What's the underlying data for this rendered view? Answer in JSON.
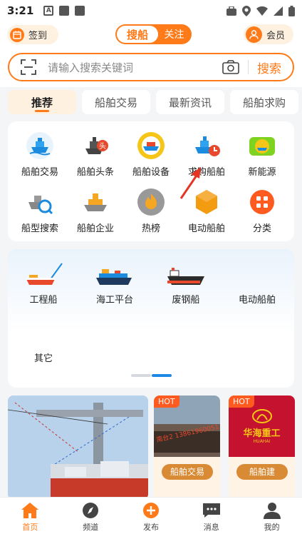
{
  "status_bar": {
    "time": "3:21"
  },
  "header": {
    "signin_label": "签到",
    "seg_active": "搜船",
    "seg_inactive": "关注",
    "member_label": "会员"
  },
  "search": {
    "placeholder": "请输入搜索关键词",
    "button": "搜索"
  },
  "tabs": [
    "推荐",
    "船舶交易",
    "最新资讯",
    "船舶求购"
  ],
  "grid": {
    "row1": [
      "船舶交易",
      "船舶头条",
      "船舶设备",
      "求购船舶",
      "新能源"
    ],
    "row2": [
      "船型搜索",
      "船舶企业",
      "热榜",
      "电动船舶",
      "分类"
    ]
  },
  "categories": {
    "row1": [
      "工程船",
      "海工平台",
      "废钢船",
      "电动船舶"
    ],
    "row2": [
      "其它"
    ]
  },
  "hot_cards": [
    {
      "tag": "HOT",
      "label": "船舶交易",
      "watermark": "南台2 13861960051"
    },
    {
      "tag": "HOT",
      "label": "船舶建",
      "logo_text": "华海重工",
      "logo_sub": "HUAHAI"
    }
  ],
  "bottom_nav": [
    "首页",
    "频道",
    "发布",
    "消息",
    "我的"
  ],
  "colors": {
    "accent": "#ff7a18",
    "pager_active": "#1e88e5"
  }
}
